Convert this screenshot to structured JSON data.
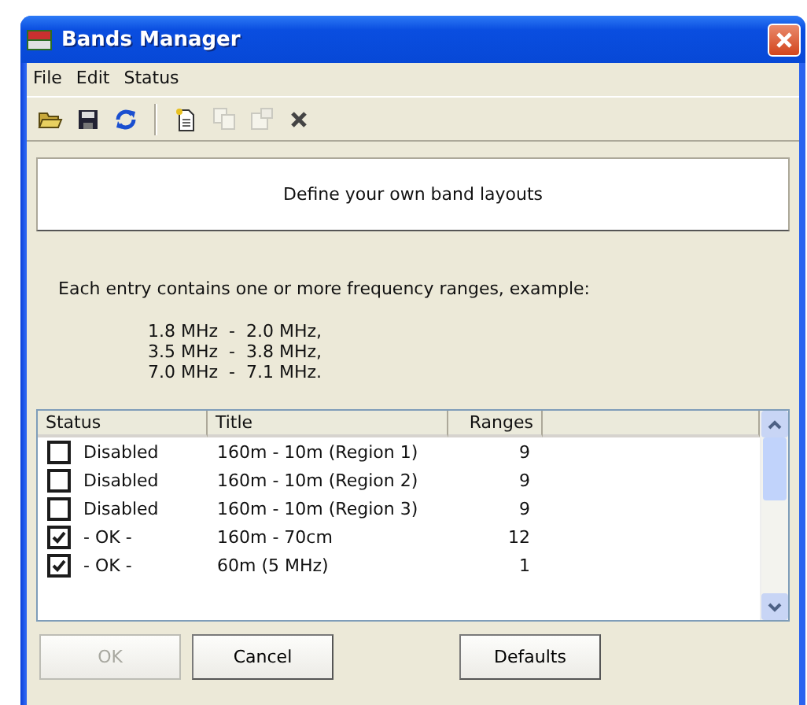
{
  "window": {
    "title": "Bands Manager"
  },
  "menu": [
    "File",
    "Edit",
    "Status"
  ],
  "toolbar": [
    {
      "kind": "open",
      "disabled": false
    },
    {
      "kind": "save",
      "disabled": false
    },
    {
      "kind": "refresh",
      "disabled": false
    },
    {
      "kind": "separator"
    },
    {
      "kind": "new",
      "disabled": false
    },
    {
      "kind": "copy",
      "disabled": true
    },
    {
      "kind": "properties",
      "disabled": true
    },
    {
      "kind": "delete",
      "disabled": false
    }
  ],
  "banner": "Define your own band layouts",
  "description": "Each entry contains one or more frequency ranges, example:",
  "example_lines": [
    "1.8 MHz  -  2.0 MHz,",
    "3.5 MHz  -  3.8 MHz,",
    "7.0 MHz  -  7.1 MHz."
  ],
  "table": {
    "columns": [
      "Status",
      "Title",
      "Ranges"
    ],
    "rows": [
      {
        "checked": false,
        "status": "Disabled",
        "title": "160m - 10m (Region 1)",
        "ranges": "9"
      },
      {
        "checked": false,
        "status": "Disabled",
        "title": "160m - 10m (Region 2)",
        "ranges": "9"
      },
      {
        "checked": false,
        "status": "Disabled",
        "title": "160m - 10m (Region 3)",
        "ranges": "9"
      },
      {
        "checked": true,
        "status": "- OK -",
        "title": "160m - 70cm",
        "ranges": "12"
      },
      {
        "checked": true,
        "status": "- OK -",
        "title": "60m (5 MHz)",
        "ranges": "1"
      }
    ]
  },
  "buttons": [
    {
      "label": "OK",
      "disabled": true
    },
    {
      "label": "Cancel",
      "disabled": false
    },
    {
      "label": "Defaults",
      "disabled": false
    }
  ]
}
